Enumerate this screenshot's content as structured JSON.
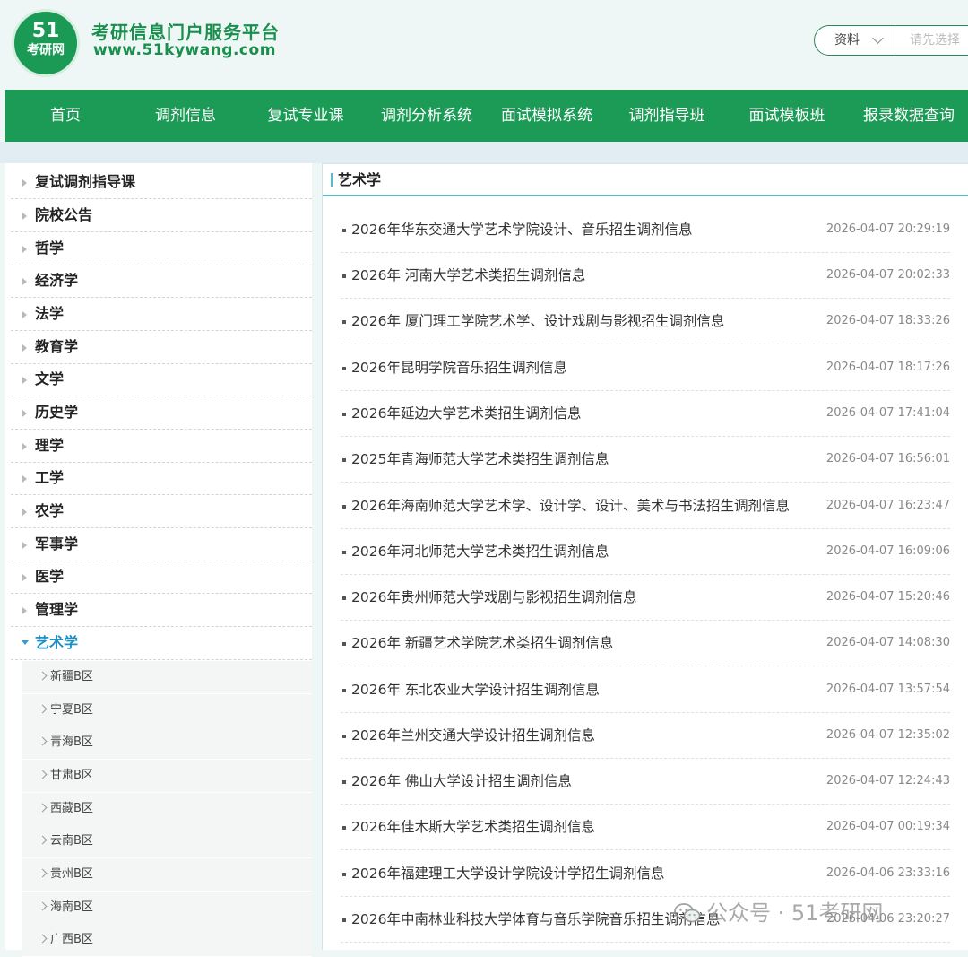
{
  "header": {
    "logo_number": "51",
    "logo_text": "考研网",
    "site_title": "考研信息门户服务平台",
    "site_url": "www.51kywang.com",
    "search_select": "资料",
    "search_placeholder": "请先选择"
  },
  "nav": [
    {
      "label": "首页"
    },
    {
      "label": "调剂信息"
    },
    {
      "label": "复试专业课"
    },
    {
      "label": "调剂分析系统"
    },
    {
      "label": "面试模拟系统"
    },
    {
      "label": "调剂指导班"
    },
    {
      "label": "面试模板班"
    },
    {
      "label": "报录数据查询"
    }
  ],
  "sidebar": {
    "items": [
      {
        "label": "复试调剂指导课"
      },
      {
        "label": "院校公告"
      },
      {
        "label": "哲学"
      },
      {
        "label": "经济学"
      },
      {
        "label": "法学"
      },
      {
        "label": "教育学"
      },
      {
        "label": "文学"
      },
      {
        "label": "历史学"
      },
      {
        "label": "理学"
      },
      {
        "label": "工学"
      },
      {
        "label": "农学"
      },
      {
        "label": "军事学"
      },
      {
        "label": "医学"
      },
      {
        "label": "管理学"
      },
      {
        "label": "艺术学",
        "active": true
      }
    ],
    "sub_items": [
      {
        "label": "新疆B区"
      },
      {
        "label": "宁夏B区"
      },
      {
        "label": "青海B区"
      },
      {
        "label": "甘肃B区"
      },
      {
        "label": "西藏B区"
      },
      {
        "label": "云南B区"
      },
      {
        "label": "贵州B区"
      },
      {
        "label": "海南B区"
      },
      {
        "label": "广西B区"
      }
    ]
  },
  "main": {
    "title": "艺术学",
    "rows": [
      {
        "title": "2026年华东交通大学艺术学院设计、音乐招生调剂信息",
        "date": "2026-04-07 20:29:19"
      },
      {
        "title": "2026年 河南大学艺术类招生调剂信息",
        "date": "2026-04-07 20:02:33"
      },
      {
        "title": "2026年 厦门理工学院艺术学、设计戏剧与影视招生调剂信息",
        "date": "2026-04-07 18:33:26"
      },
      {
        "title": "2026年昆明学院音乐招生调剂信息",
        "date": "2026-04-07 18:17:26"
      },
      {
        "title": "2026年延边大学艺术类招生调剂信息",
        "date": "2026-04-07 17:41:04"
      },
      {
        "title": "2025年青海师范大学艺术类招生调剂信息",
        "date": "2026-04-07 16:56:01"
      },
      {
        "title": "2026年海南师范大学艺术学、设计学、设计、美术与书法招生调剂信息",
        "date": "2026-04-07 16:23:47"
      },
      {
        "title": "2026年河北师范大学艺术类招生调剂信息",
        "date": "2026-04-07 16:09:06"
      },
      {
        "title": "2026年贵州师范大学戏剧与影视招生调剂信息",
        "date": "2026-04-07 15:20:46"
      },
      {
        "title": "2026年 新疆艺术学院艺术类招生调剂信息",
        "date": "2026-04-07 14:08:30"
      },
      {
        "title": "2026年 东北农业大学设计招生调剂信息",
        "date": "2026-04-07 13:57:54"
      },
      {
        "title": "2026年兰州交通大学设计招生调剂信息",
        "date": "2026-04-07 12:35:02"
      },
      {
        "title": "2026年 佛山大学设计招生调剂信息",
        "date": "2026-04-07 12:24:43"
      },
      {
        "title": "2026年佳木斯大学艺术类招生调剂信息",
        "date": "2026-04-07 00:19:34"
      },
      {
        "title": "2026年福建理工大学设计学院设计学招生调剂信息",
        "date": "2026-04-06 23:33:16"
      },
      {
        "title": "2026年中南林业科技大学体育与音乐学院音乐招生调剂信息",
        "date": "2026-04-06 23:20:27"
      }
    ]
  },
  "watermark": {
    "text": "公众号 · 51考研网",
    "icon": "wechat-icon"
  },
  "colors": {
    "brand_green": "#1c9b57",
    "accent_blue": "#1f8ec4",
    "header_rule": "#5fb7c8"
  }
}
